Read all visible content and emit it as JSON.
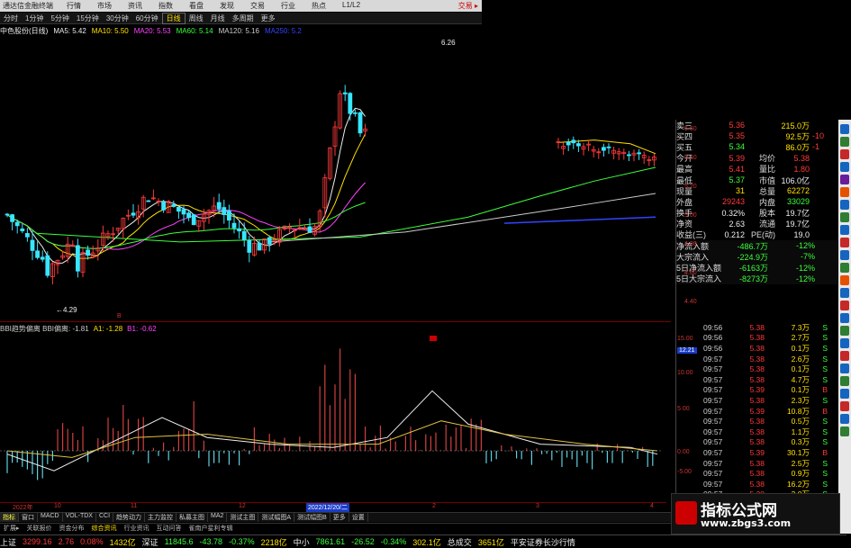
{
  "titlebar": {
    "app": "通达信金融终端",
    "menus": [
      "行情",
      "市场",
      "资讯",
      "指数",
      "看盘",
      "发现",
      "交易",
      "行业",
      "热点",
      "L1/L2"
    ],
    "right": "交易 ▸"
  },
  "periodbar": {
    "items": [
      "分时",
      "1分钟",
      "5分钟",
      "15分钟",
      "30分钟",
      "60分钟",
      "日线",
      "周线",
      "月线",
      "多周期",
      "更多"
    ],
    "active_index": 6
  },
  "ma_line": [
    {
      "text": "中色股份(日线)",
      "color": "#eeeeee"
    },
    {
      "text": "MA5: 5.42",
      "color": "#eeeeee"
    },
    {
      "text": "MA10: 5.50",
      "color": "#ffe000"
    },
    {
      "text": "MA20: 5.53",
      "color": "#ff44ff"
    },
    {
      "text": "MA60: 5.14",
      "color": "#3cff3c"
    },
    {
      "text": "MA120: 5.16",
      "color": "#cccccc"
    },
    {
      "text": "MA250: 5.2",
      "color": "#3344ff"
    }
  ],
  "price_labels": {
    "high_mark": "6.26",
    "low_mark": "4.29"
  },
  "right_price_axis": [
    "5.60",
    "5.40",
    "5.20",
    "5.00",
    "4.80",
    "4.60",
    "4.40"
  ],
  "indicator_line": [
    {
      "text": "BBI趋势偏离 BBI偏离: -1.81",
      "color": "#cccccc"
    },
    {
      "text": "A1: -1.28",
      "color": "#ffe000"
    },
    {
      "text": "B1: -0.62",
      "color": "#ff44ff"
    }
  ],
  "ind_axis": [
    "15.00",
    "12.21",
    "10.00",
    "5.00",
    "0.00",
    "-5.00"
  ],
  "ind_highlight": "12.21",
  "dates": [
    "2022年",
    "10",
    "11",
    "12",
    "2022/12/20/二",
    "2",
    "3",
    "4"
  ],
  "bottom_tabs": [
    "指标",
    "窗口",
    "MACD",
    "VOL-TDX",
    "CCI",
    "趋势动力",
    "主力监控",
    "私募主图",
    "MA2",
    "测试主图",
    "测试幅图A",
    "测试幅图B",
    "更多",
    "设置"
  ],
  "bottom_tabs_active": 0,
  "lower_bar": [
    "扩展▸",
    "关联报价",
    "资金分布",
    "综合资讯",
    "行业资讯",
    "互动问答",
    "雀南户星利专辑"
  ],
  "quote": {
    "rows": [
      {
        "k": "卖三",
        "v": "5.36",
        "vc": "#ff3a3a",
        "k2": "",
        "v2": "215.0万",
        "v2c": "#ffe000",
        "extra": ""
      },
      {
        "k": "买四",
        "v": "5.35",
        "vc": "#ff3a3a",
        "k2": "",
        "v2": "92.5万",
        "v2c": "#ffe000",
        "extra": "-10"
      },
      {
        "k": "买五",
        "v": "5.34",
        "vc": "#3cff3c",
        "k2": "",
        "v2": "86.0万",
        "v2c": "#ffe000",
        "extra": "-1"
      },
      {
        "k": "今开",
        "v": "5.39",
        "vc": "#ff3a3a",
        "k2": "均价",
        "v2": "5.38",
        "v2c": "#ff3a3a",
        "extra": ""
      },
      {
        "k": "最高",
        "v": "5.41",
        "vc": "#ff3a3a",
        "k2": "量比",
        "v2": "1.80",
        "v2c": "#ff3a3a",
        "extra": ""
      },
      {
        "k": "最低",
        "v": "5.37",
        "vc": "#3cff3c",
        "k2": "市值",
        "v2": "106.0亿",
        "v2c": "#eeeeee",
        "extra": ""
      },
      {
        "k": "现量",
        "v": "31",
        "vc": "#ffe000",
        "k2": "总量",
        "v2": "62272",
        "v2c": "#ffe000",
        "extra": ""
      },
      {
        "k": "外盘",
        "v": "29243",
        "vc": "#ff3a3a",
        "k2": "内盘",
        "v2": "33029",
        "v2c": "#3cff3c",
        "extra": ""
      },
      {
        "k": "换手",
        "v": "0.32%",
        "vc": "#eeeeee",
        "k2": "股本",
        "v2": "19.7亿",
        "v2c": "#eeeeee",
        "extra": ""
      },
      {
        "k": "净资",
        "v": "2.63",
        "vc": "#eeeeee",
        "k2": "流通",
        "v2": "19.7亿",
        "v2c": "#eeeeee",
        "extra": ""
      },
      {
        "k": "收益(三)",
        "v": "0.212",
        "vc": "#eeeeee",
        "k2": "PE(动)",
        "v2": "19.0",
        "v2c": "#eeeeee",
        "extra": ""
      },
      {
        "k": "净流入额",
        "v": "-486.7万",
        "vc": "#3cff3c",
        "k2": "",
        "v2": "-12%",
        "v2c": "#3cff3c",
        "extra": ""
      },
      {
        "k": "大宗流入",
        "v": "-224.9万",
        "vc": "#3cff3c",
        "k2": "",
        "v2": "-7%",
        "v2c": "#3cff3c",
        "extra": ""
      },
      {
        "k": "5日净流入额",
        "v": "-6163万",
        "vc": "#3cff3c",
        "k2": "",
        "v2": "-12%",
        "v2c": "#3cff3c",
        "extra": ""
      },
      {
        "k": "5日大宗流入",
        "v": "-8273万",
        "vc": "#3cff3c",
        "k2": "",
        "v2": "-12%",
        "v2c": "#3cff3c",
        "extra": ""
      }
    ]
  },
  "quote_top_prices": [
    "5.60",
    "5.40"
  ],
  "trades": [
    {
      "t": "09:56",
      "p": "5.38",
      "vol": "7.3万",
      "s": "S",
      "sc": "#3cff3c"
    },
    {
      "t": "09:56",
      "p": "5.38",
      "vol": "2.7万",
      "s": "S",
      "sc": "#3cff3c"
    },
    {
      "t": "09:56",
      "p": "5.38",
      "vol": "0.1万",
      "s": "S",
      "sc": "#3cff3c"
    },
    {
      "t": "09:57",
      "p": "5.38",
      "vol": "2.6万",
      "s": "S",
      "sc": "#3cff3c"
    },
    {
      "t": "09:57",
      "p": "5.38",
      "vol": "0.1万",
      "s": "S",
      "sc": "#3cff3c"
    },
    {
      "t": "09:57",
      "p": "5.38",
      "vol": "4.7万",
      "s": "S",
      "sc": "#3cff3c"
    },
    {
      "t": "09:57",
      "p": "5.39",
      "vol": "0.1万",
      "s": "B",
      "sc": "#ff3a3a"
    },
    {
      "t": "09:57",
      "p": "5.38",
      "vol": "2.3万",
      "s": "S",
      "sc": "#3cff3c"
    },
    {
      "t": "09:57",
      "p": "5.39",
      "vol": "10.8万",
      "s": "B",
      "sc": "#ff3a3a"
    },
    {
      "t": "09:57",
      "p": "5.38",
      "vol": "0.5万",
      "s": "S",
      "sc": "#3cff3c"
    },
    {
      "t": "09:57",
      "p": "5.38",
      "vol": "1.1万",
      "s": "S",
      "sc": "#3cff3c"
    },
    {
      "t": "09:57",
      "p": "5.38",
      "vol": "0.3万",
      "s": "S",
      "sc": "#3cff3c"
    },
    {
      "t": "09:57",
      "p": "5.39",
      "vol": "30.1万",
      "s": "B",
      "sc": "#ff3a3a"
    },
    {
      "t": "09:57",
      "p": "5.38",
      "vol": "2.5万",
      "s": "S",
      "sc": "#3cff3c"
    },
    {
      "t": "09:57",
      "p": "5.38",
      "vol": "0.9万",
      "s": "S",
      "sc": "#3cff3c"
    },
    {
      "t": "09:57",
      "p": "5.38",
      "vol": "16.2万",
      "s": "S",
      "sc": "#3cff3c"
    },
    {
      "t": "09:57",
      "p": "5.38",
      "vol": "3.0万",
      "s": "S",
      "sc": "#3cff3c"
    }
  ],
  "status": [
    {
      "text": "上证",
      "c": "#eeeeee"
    },
    {
      "text": "3299.16",
      "c": "#ff3a3a"
    },
    {
      "text": "2.76",
      "c": "#ff3a3a"
    },
    {
      "text": "0.08%",
      "c": "#ff3a3a"
    },
    {
      "text": "1432亿",
      "c": "#ffe000"
    },
    {
      "text": "深证",
      "c": "#eeeeee"
    },
    {
      "text": "11845.6",
      "c": "#3cff3c"
    },
    {
      "text": "-43.78",
      "c": "#3cff3c"
    },
    {
      "text": "-0.37%",
      "c": "#3cff3c"
    },
    {
      "text": "2218亿",
      "c": "#ffe000"
    },
    {
      "text": "中小",
      "c": "#eeeeee"
    },
    {
      "text": "7861.61",
      "c": "#3cff3c"
    },
    {
      "text": "-26.52",
      "c": "#3cff3c"
    },
    {
      "text": "-0.34%",
      "c": "#3cff3c"
    },
    {
      "text": "302.1亿",
      "c": "#ffe000"
    },
    {
      "text": "总成交",
      "c": "#eeeeee"
    },
    {
      "text": "3651亿",
      "c": "#ffe000"
    },
    {
      "text": "平安证券长沙行情",
      "c": "#eeeeee"
    }
  ],
  "watermark": {
    "title": "指标公式网",
    "url": "www.zbgs3.com"
  },
  "colors": {
    "up": "#ff3a3a",
    "down": "#38e6ff",
    "ma5": "#eeeeee",
    "ma10": "#ffe000",
    "ma20": "#ff44ff",
    "ma60": "#3cff3c",
    "ma120": "#cccccc",
    "ma250": "#3344ff"
  },
  "tr_right": "交易"
}
